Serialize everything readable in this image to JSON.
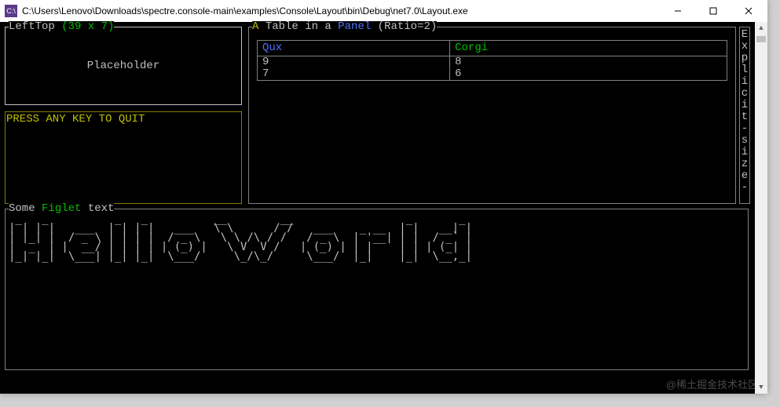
{
  "window": {
    "title": "C:\\Users\\Lenovo\\Downloads\\spectre.console-main\\examples\\Console\\Layout\\bin\\Debug\\net7.0\\Layout.exe",
    "icon_label": "C:\\"
  },
  "lefttop": {
    "label_prefix": "LeftTop ",
    "label_dims": "(39 x 7)",
    "body": "Placeholder"
  },
  "press_panel": {
    "text": "PRESS ANY KEY TO QUIT"
  },
  "table_panel": {
    "label_a": "A ",
    "label_table": "Table",
    "label_in_a": " in a ",
    "label_panel": "Panel",
    "label_ratio": " (Ratio=2)",
    "columns": [
      "Qux",
      "Corgi"
    ],
    "rows": [
      [
        "9",
        "8"
      ],
      [
        "7",
        "6"
      ]
    ]
  },
  "side_text": "Explicit-size-",
  "figlet_panel": {
    "label_some": "Some ",
    "label_figlet": "Figlet",
    "label_text": " text",
    "ascii": " _   _          _   _          __        __                 _       _ \n| | | |   ___  | | | |   ___   \\ \\      / /   ___    _ __  | |   __| |\n| |_| |  / _ \\ | | | |  / _ \\   \\ \\ /\\ / /   / _ \\  | '__| | |  / _` |\n|  _  | |  __/ | | | | | (_) |   \\ V  V /   | (_) | | |    | | | (_| |\n|_| |_|  \\___| |_| |_|  \\___/     \\_/\\_/     \\___/  |_|    |_|  \\__,_|"
  },
  "watermark": "@稀土掘金技术社区"
}
